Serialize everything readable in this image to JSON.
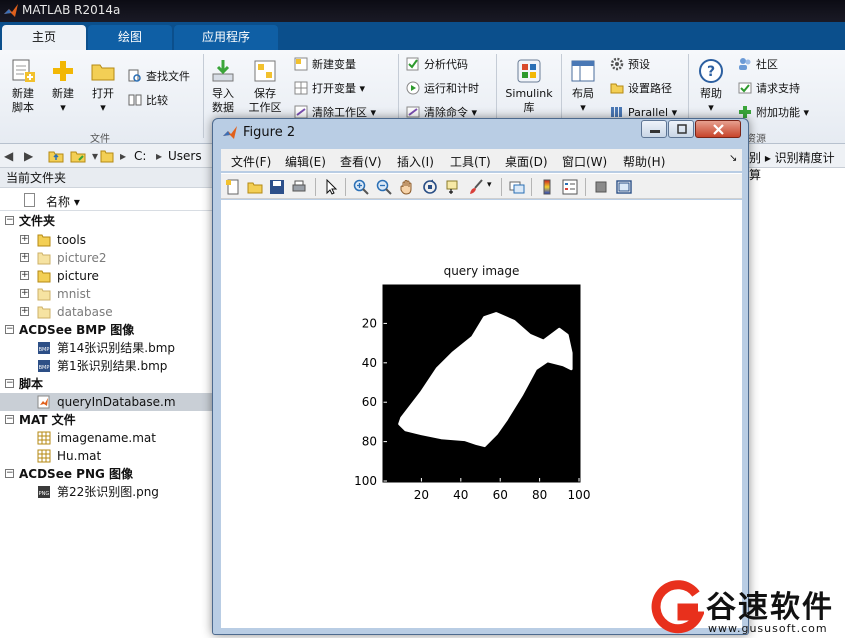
{
  "window": {
    "title": "MATLAB R2014a"
  },
  "tabs": [
    {
      "label": "主页",
      "active": true
    },
    {
      "label": "绘图",
      "active": false
    },
    {
      "label": "应用程序",
      "active": false
    }
  ],
  "ribbon": {
    "new_script": "新建\n脚本",
    "new": "新建",
    "open": "打开",
    "find_files": "查找文件",
    "compare": "比较",
    "group_file": "文件",
    "import_data": "导入\n数据",
    "save_workspace": "保存\n工作区",
    "new_variable": "新建变量",
    "open_variable": "打开变量",
    "clear_workspace": "清除工作区",
    "analyze_code": "分析代码",
    "run_and_time": "运行和计时",
    "clear_commands": "清除命令",
    "simulink": "Simulink\n库",
    "layout": "布局",
    "preferences": "预设",
    "set_path": "设置路径",
    "parallel": "Parallel",
    "help": "帮助",
    "community": "社区",
    "request_support": "请求支持",
    "add_ons": "附加功能",
    "group_resources": "资源"
  },
  "address": {
    "root": "C:",
    "segment": "Users",
    "right_tail": "别 ▸ 识别精度计算"
  },
  "current_folder": {
    "title": "当前文件夹",
    "column": "名称",
    "groups": [
      {
        "label": "文件夹",
        "items": [
          {
            "name": "tools",
            "dim": false
          },
          {
            "name": "picture2",
            "dim": true
          },
          {
            "name": "picture",
            "dim": false
          },
          {
            "name": "mnist",
            "dim": true
          },
          {
            "name": "database",
            "dim": true
          }
        ]
      },
      {
        "label": "ACDSee BMP 图像",
        "items": [
          {
            "name": "第14张识别结果.bmp"
          },
          {
            "name": "第1张识别结果.bmp"
          }
        ]
      },
      {
        "label": "脚本",
        "items": [
          {
            "name": "queryInDatabase.m",
            "selected": true
          }
        ]
      },
      {
        "label": "MAT 文件",
        "items": [
          {
            "name": "imagename.mat"
          },
          {
            "name": "Hu.mat"
          }
        ]
      },
      {
        "label": "ACDSee PNG 图像",
        "items": [
          {
            "name": "第22张识别图.png"
          }
        ]
      }
    ]
  },
  "figure": {
    "title": "Figure 2",
    "menu": [
      "文件(F)",
      "编辑(E)",
      "查看(V)",
      "插入(I)",
      "工具(T)",
      "桌面(D)",
      "窗口(W)",
      "帮助(H)"
    ],
    "menu_overflow": "↘"
  },
  "chart_data": {
    "type": "image",
    "title": "query image",
    "xlabel": "",
    "ylabel": "",
    "xlim": [
      0.5,
      100.5
    ],
    "ylim": [
      0.5,
      100.5
    ],
    "y_reversed": true,
    "xticks": [
      20,
      40,
      60,
      80,
      100
    ],
    "yticks": [
      20,
      40,
      60,
      80,
      100
    ],
    "background": "#000000",
    "foreground": "#ffffff",
    "shape_outline": [
      [
        10,
        68
      ],
      [
        20,
        55
      ],
      [
        28,
        43
      ],
      [
        36,
        35
      ],
      [
        46,
        27
      ],
      [
        52,
        17
      ],
      [
        58,
        15
      ],
      [
        67,
        19
      ],
      [
        75,
        26
      ],
      [
        82,
        29
      ],
      [
        90,
        23
      ],
      [
        94,
        26
      ],
      [
        96,
        35
      ],
      [
        96,
        43
      ],
      [
        92,
        41
      ],
      [
        84,
        39
      ],
      [
        78,
        43
      ],
      [
        71,
        56
      ],
      [
        63,
        69
      ],
      [
        58,
        76
      ],
      [
        52,
        82
      ],
      [
        48,
        81
      ],
      [
        42,
        79
      ],
      [
        30,
        78
      ],
      [
        20,
        76
      ],
      [
        12,
        74
      ],
      [
        9,
        71
      ]
    ]
  },
  "watermark": {
    "brand": "谷速软件",
    "url": "www.gususoft.com"
  },
  "colors": {
    "tab_blue": "#0b4f8c",
    "figure_frame": "#b9cde4",
    "accent": "#e8301c"
  }
}
